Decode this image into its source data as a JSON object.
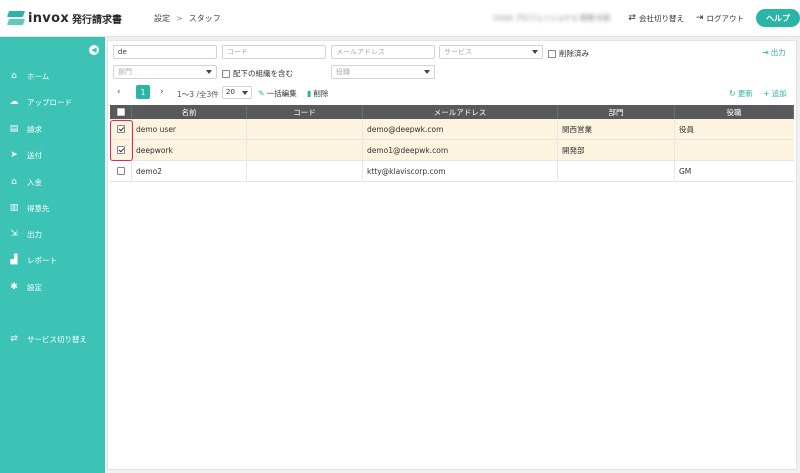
{
  "header": {
    "logo_text": "invox",
    "logo_sub": "発行請求書",
    "breadcrumb": [
      "設定",
      "スタッフ"
    ],
    "breadcrumb_sep": ">",
    "account": "invox プロフェッショナル 新規 社長",
    "switch_company": "会社切り替え",
    "logout": "ログアウト",
    "help": "ヘルプ",
    "brand_color": "#2bb5a7"
  },
  "sidebar": {
    "bg_color": "#3cc3b6",
    "items": [
      {
        "label": "ホーム",
        "icon": "home-icon"
      },
      {
        "label": "アップロード",
        "icon": "cloud-upload-icon"
      },
      {
        "label": "請求",
        "icon": "document-icon"
      },
      {
        "label": "送付",
        "icon": "paper-plane-icon"
      },
      {
        "label": "入金",
        "icon": "bank-icon"
      },
      {
        "label": "得意先",
        "icon": "building-icon"
      },
      {
        "label": "出力",
        "icon": "export-icon"
      },
      {
        "label": "レポート",
        "icon": "chart-icon"
      },
      {
        "label": "設定",
        "icon": "gear-icon"
      }
    ],
    "service_switch": "サービス切り替え"
  },
  "filters": {
    "name_value": "de",
    "code_placeholder": "コード",
    "email_placeholder": "メールアドレス",
    "service_placeholder": "サービス",
    "deleted_label": "削除済み",
    "dept_placeholder": "部門",
    "include_sub_label": "配下の組織を含む",
    "role_placeholder": "役職",
    "export_label": "出力"
  },
  "toolbar": {
    "current_page": "1",
    "range_text": "1〜3 /全3件",
    "per_page": "20",
    "bulk_edit": "一括編集",
    "delete": "削除",
    "refresh": "更新",
    "add": "追加"
  },
  "table": {
    "columns": [
      "名前",
      "コード",
      "メールアドレス",
      "部門",
      "役職"
    ],
    "rows": [
      {
        "checked": true,
        "name": "demo user",
        "code": "",
        "email": "demo@deepwk.com",
        "dept": "関西営業",
        "role": "役員"
      },
      {
        "checked": true,
        "name": "deepwork",
        "code": "",
        "email": "demo1@deepwk.com",
        "dept": "開発部",
        "role": ""
      },
      {
        "checked": false,
        "name": "demo2",
        "code": "",
        "email": "ktty@klaviscorp.com",
        "dept": "",
        "role": "GM"
      }
    ],
    "selected_row_color": "#fdf4df",
    "header_color": "#58595b",
    "highlight_color": "#e0285a"
  }
}
